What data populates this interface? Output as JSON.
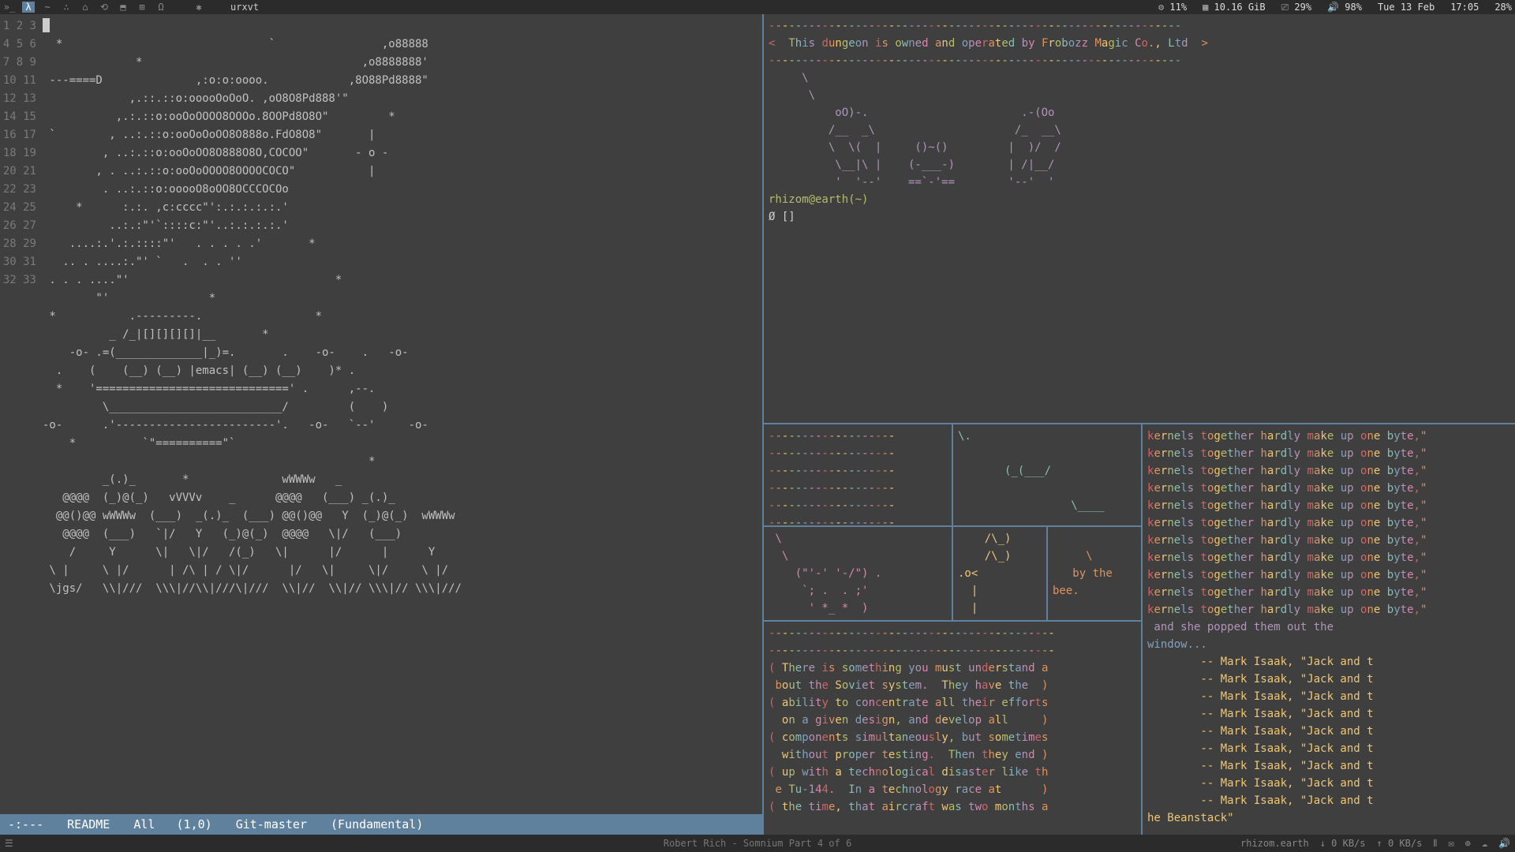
{
  "topbar": {
    "title": "urxvt",
    "icons": [
      "»_",
      "λ",
      "~",
      "∴",
      "⌂",
      "⟲",
      "⬒",
      "⊞",
      "Ω",
      "",
      "✱"
    ],
    "status": {
      "bat_pct": "11%",
      "ram": "10.16 GiB",
      "cpu_pct": "29%",
      "vol_pct": "98%",
      "date": "Tue 13 Feb",
      "time": "17:05",
      "right_pct": "28%"
    }
  },
  "emacs": {
    "line_count": 33,
    "ascii": "\n  *                               `                ,o88888\n              *                                 ,o8888888'\n ---====D              ,:o:o:oooo.            ,8O88Pd8888\"\n             ,.::.::o:ooooOoOoO. ,oO8O8Pd888'\"\n           ,.:.::o:ooOoOOOO8OOOo.8OOPd8O8O\"         *\n `        , ..:.::o:ooOoOoOO8O888o.FdO8O8\"       |\n         , ..:.::o:ooOoOO8O888O8O,COCOO\"       - o -\n        , . ..:.::o:ooOoOOOO8OOOOCOCO\"           |\n         . ..:.::o:ooooO8oOO8OCCCOCOo\n     *      :.:. ,c:cccc\"':.:.:.:.:.'\n          ..:.:\"'`::::c:\"'..:.:.:.:.'\n    ....:.'.:.::::\"'   . . . . .'       *\n   .. . ....:.\"' `   .  . . ''\n . . . ....\"'                               *\n        \"'               *\n *           .---------.                 *\n          _ /_|[][][][]|__       *\n    -o- .=(_____________|_)=.       .    -o-    .   -o-\n  .    (    (__) (__) |emacs| (__) (__)    )* .\n  *    '=============================' .      ,--.\n         \\__________________________/         (    )\n-o-      .'------------------------'.   -o-   `--'     -o-\n    *          `\"==========\"`\n                                                 *\n         _(.)_       *              wWWWw   _\n   @@@@  (_)@(_)   vVVVv    _      @@@@   (___) _(.)_\n  @@()@@ wWWWw  (___)  _(.)_  (___) @@()@@   Y  (_)@(_)  wWWWw\n   @@@@  (___)   `|/   Y   (_)@(_)  @@@@   \\|/   (___)\n    /     Y      \\|   \\|/   /(_)   \\|      |/      |      Y\n \\ |     \\ |/      | /\\ | / \\|/      |/   \\|     \\|/     \\ |/\n \\jgs/   \\\\|///  \\\\\\|//\\\\|///\\|///  \\\\|//  \\\\|// \\\\\\|// \\\\\\|///",
    "modeline": {
      "left": "-:---",
      "buffer": "README",
      "pos": "All   (1,0)",
      "vc": "Git-master",
      "mode": "(Fundamental)"
    }
  },
  "term_top": {
    "banner_dashes": "--------------------------------------------------------------",
    "banner": "<  This dungeon is owned and operated by Frobozz Magic Co., Ltd  >",
    "art": "     \\\n      \\\n          oO)-.                       .-(Oo\n         /__  _\\                     /_  __\\\n         \\  \\(  |     ()~()         |  )/  /\n          \\__|\\ |    (-___-)        | /|__/\n          '  '--'    ==`-'==        '--'  '",
    "prompt": "rhizom@earth(~)",
    "ps2": "Ø []"
  },
  "tiles": {
    "a_dashes": "-------------------\n-------------------\n-------------------\n-------------------\n-------------------\n-------------------",
    "b_art": "\\.\n\n       (_(___/\n\n                 \\____",
    "c_art": " \\\n  \\\n    (\"'-' '-/\") .\n     `; .  . ;'\n      ' *_ *  )",
    "d_art": "    /\\_)\n    /\\_)\n.o<\n  |\n  |",
    "e_text": "\n     \\\n   by the\nbee.",
    "quote_dashes": "-------------------------------------------\n-------------------------------------------",
    "quote": "( There is something you must understand a\n bout the Soviet system.  They have the  )\n( ability to concentrate all their efforts\n  on a given design, and develop all     )\n( components simultaneously, but sometimes\n  without proper testing.  Then they end )\n( up with a technological disaster like th\n e Tu-144.  In a technology race at      )\n( the time, that aircraft was two months a"
  },
  "rightcol": {
    "line": "kernels together hardly make up one byte,\"",
    "tail1": " and she popped them out the",
    "tail2": "window...",
    "attrib": "        -- Mark Isaak, \"Jack and t",
    "tail3": "he Beanstack\"",
    "repeat_count": 11,
    "attrib_count": 9
  },
  "botbar": {
    "center": "Robert Rich - Somnium Part 4 of 6",
    "host": "rhizom.earth",
    "down": "↓ 0 KB/s",
    "up": "↑ 0 KB/s"
  }
}
